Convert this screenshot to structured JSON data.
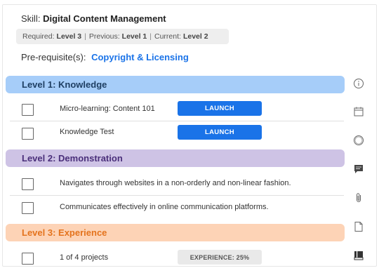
{
  "skill": {
    "prefix": "Skill:",
    "name": "Digital Content Management"
  },
  "levels_info": {
    "required_label": "Required:",
    "required_value": "Level 3",
    "previous_label": "Previous:",
    "previous_value": "Level 1",
    "current_label": "Current:",
    "current_value": "Level 2",
    "separator": "|"
  },
  "prerequisites": {
    "label": "Pre-requisite(s):",
    "link": "Copyright & Licensing"
  },
  "level1": {
    "title": "Level 1: Knowledge",
    "items": [
      {
        "label": "Micro-learning: Content 101",
        "action": "LAUNCH"
      },
      {
        "label": "Knowledge Test",
        "action": "LAUNCH"
      }
    ]
  },
  "level2": {
    "title": "Level 2: Demonstration",
    "items": [
      {
        "label": "Navigates through websites in a non-orderly and non-linear fashion."
      },
      {
        "label": "Communicates effectively in online communication platforms."
      }
    ]
  },
  "level3": {
    "title": "Level 3: Experience",
    "items": [
      {
        "label": "1 of 4 projects",
        "action": "EXPERIENCE: 25%"
      }
    ]
  },
  "sidebar_icons": [
    "info-icon",
    "calendar-icon",
    "target-icon",
    "comment-icon",
    "paperclip-icon",
    "document-icon",
    "book-icon"
  ],
  "colors": {
    "level1_bar": "#a6cdf9",
    "level2_bar": "#cec3e5",
    "level3_bar": "#fdd3b6",
    "accent": "#1a73e8",
    "level3_text": "#e4731d"
  }
}
